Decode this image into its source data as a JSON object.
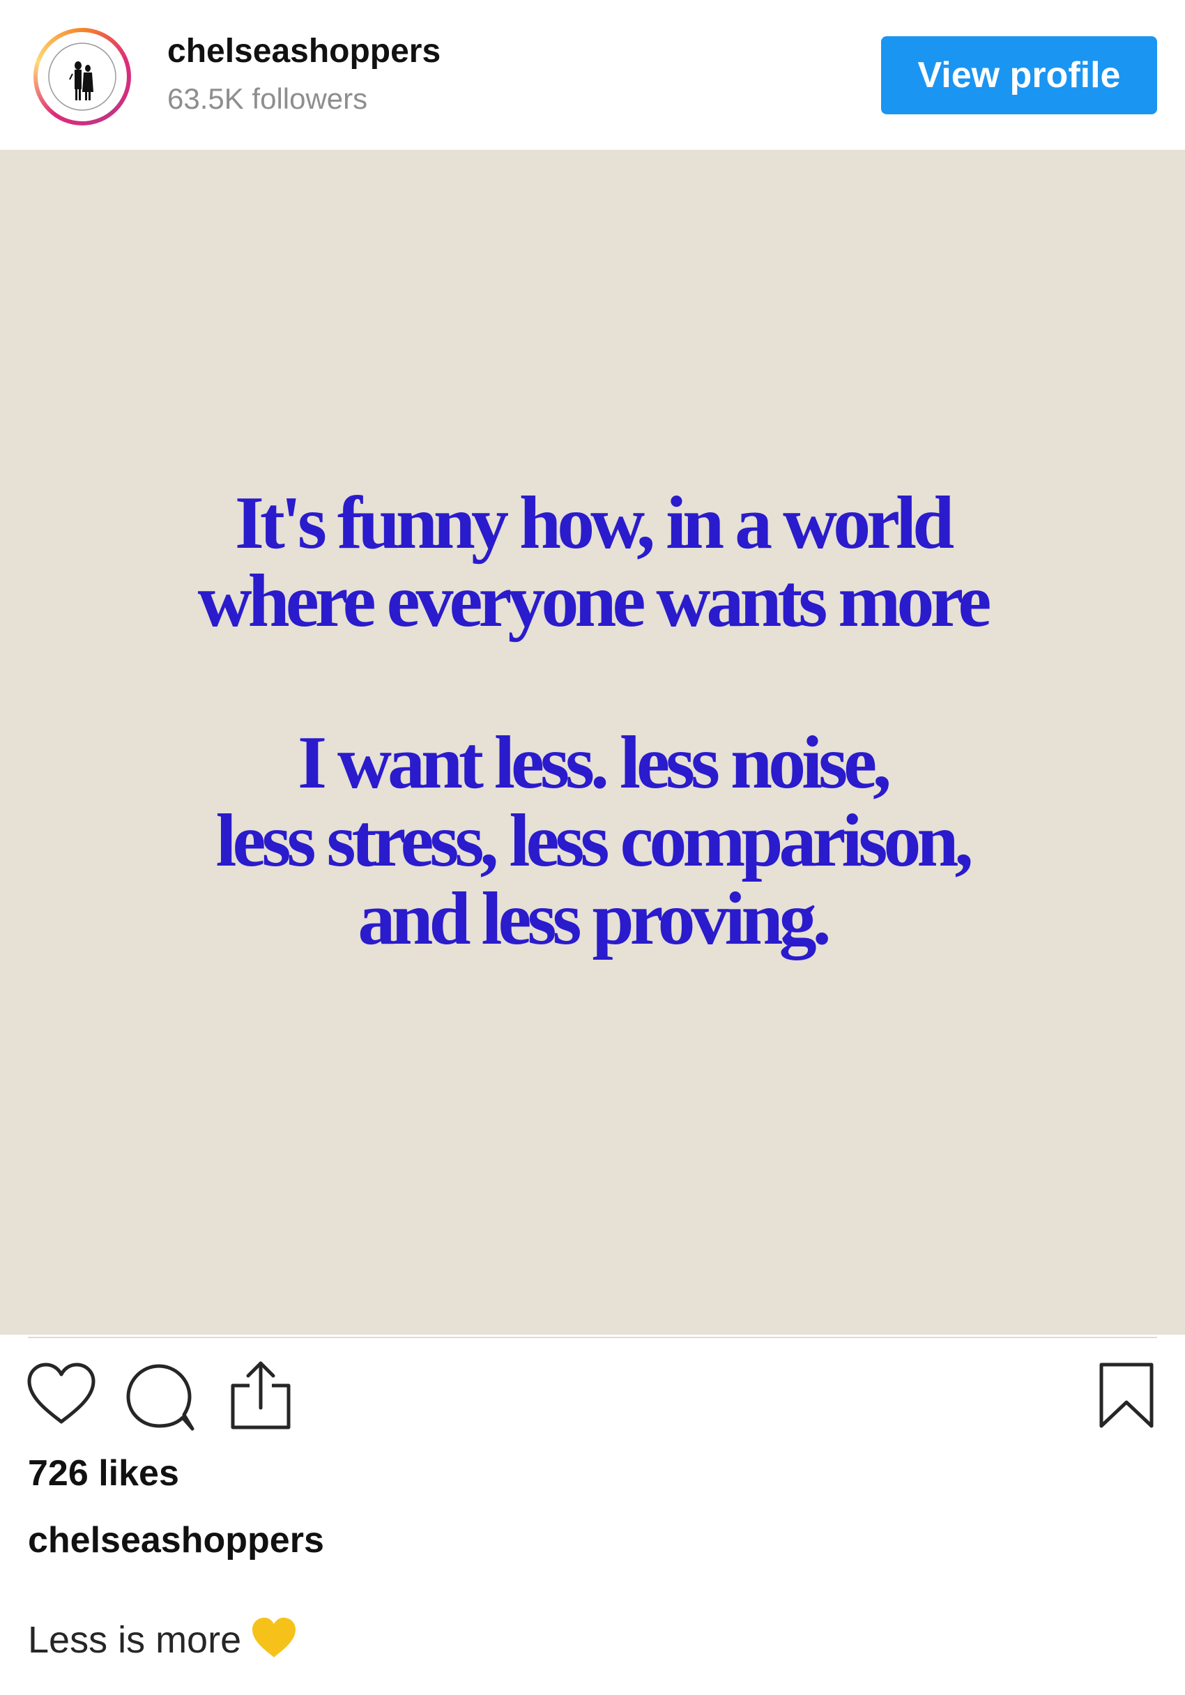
{
  "header": {
    "username": "chelseashoppers",
    "followers": "63.5K followers",
    "view_profile_label": "View profile",
    "button_color": "#1a95f2"
  },
  "post": {
    "background_color": "#e6e0d5",
    "text_color": "#2a1bcc",
    "quote_lines_1": [
      "It's funny how, in a world",
      "where everyone wants more"
    ],
    "quote_lines_2": [
      "I want less. less noise,",
      "less stress, less comparison,",
      "and less proving."
    ]
  },
  "actions": {
    "icons": [
      "heart-icon",
      "comment-icon",
      "share-icon",
      "bookmark-icon"
    ]
  },
  "likes": "726 likes",
  "caption": {
    "username": "chelseashoppers",
    "text": "Less is more",
    "emoji": "yellow-heart-icon"
  }
}
